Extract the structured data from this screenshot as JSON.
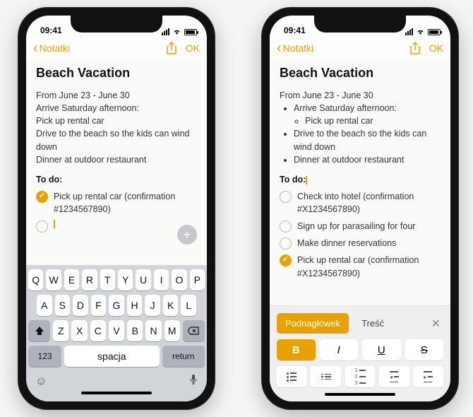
{
  "status": {
    "time": "09:41"
  },
  "nav": {
    "back": "Notatki",
    "done": "OK"
  },
  "note": {
    "title": "Beach Vacation",
    "date_line": "From June 23 - June 30",
    "todo_head": "To do:"
  },
  "left": {
    "lines": {
      "l1": "Arrive Saturday afternoon:",
      "l2": "Pick up rental car",
      "l3": "Drive to the beach so the kids can wind down",
      "l4": "Dinner at outdoor restaurant"
    },
    "todo_item": "Pick up rental car (confirmation #1234567890)"
  },
  "right": {
    "bullets": {
      "b1": "Arrive Saturday afternoon:",
      "b1a": "Pick up rental car",
      "b2": "Drive to the beach so the kids can wind down",
      "b3": "Dinner at outdoor restaurant"
    },
    "todos": {
      "t1": "Check into hotel (confirmation #X1234567890)",
      "t2": "Sign up for parasailing for four",
      "t3": "Make dinner reservations",
      "t4": "Pick up rental car (confirmation #X1234567890)"
    }
  },
  "keyboard": {
    "r1": [
      "Q",
      "W",
      "E",
      "R",
      "T",
      "Y",
      "U",
      "I",
      "O",
      "P"
    ],
    "r2": [
      "A",
      "S",
      "D",
      "F",
      "G",
      "H",
      "J",
      "K",
      "L"
    ],
    "r3": [
      "Z",
      "X",
      "C",
      "V",
      "B",
      "N",
      "M"
    ],
    "num": "123",
    "space": "spacja",
    "ret": "return"
  },
  "fmt": {
    "style1": "Podnagłówek",
    "style2": "Treść",
    "b": "B",
    "i": "I",
    "u": "U",
    "s": "S"
  }
}
